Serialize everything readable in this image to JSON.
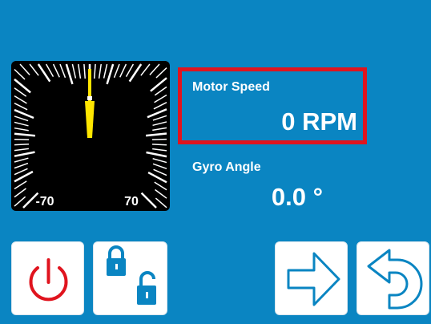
{
  "gauge": {
    "min_label": "-70",
    "max_label": "70",
    "needle_value": 0,
    "needle_color": "#ffe600"
  },
  "motor": {
    "label": "Motor Speed",
    "value": "0 RPM",
    "highlight_color": "#e0141e"
  },
  "gyro": {
    "label": "Gyro Angle",
    "value": "0.0 °"
  },
  "buttons": {
    "power": {
      "icon": "power-icon",
      "color": "#e0141e"
    },
    "lock": {
      "icon": "lock-unlock-icon",
      "color": "#0a85c2"
    },
    "forward": {
      "icon": "arrow-right-icon",
      "color": "#0a85c2"
    },
    "back": {
      "icon": "undo-icon",
      "color": "#0a85c2"
    }
  },
  "colors": {
    "background": "#0a85c2"
  }
}
